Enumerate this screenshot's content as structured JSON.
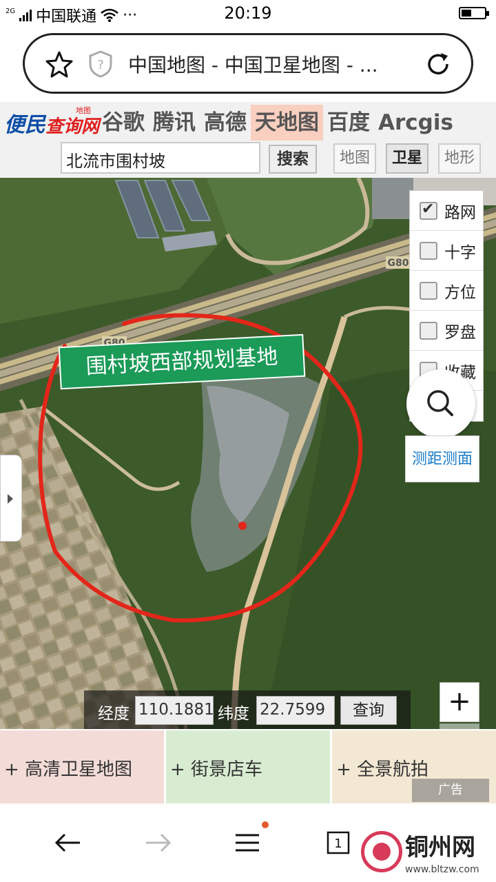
{
  "status": {
    "network": "2G",
    "carrier": "中国联通",
    "more": "···",
    "time": "20:19"
  },
  "browser": {
    "page_title": "中国地图 - 中国卫星地图 - ..."
  },
  "site": {
    "logo_main": "便民",
    "logo_sub": "查询网",
    "logo_tag": "地图",
    "tabs": [
      {
        "label": "谷歌",
        "active": false
      },
      {
        "label": "腾讯",
        "active": false
      },
      {
        "label": "高德",
        "active": false
      },
      {
        "label": "天地图",
        "active": true
      },
      {
        "label": "百度",
        "active": false
      },
      {
        "label": "Arcgis",
        "active": false
      }
    ],
    "search_value": "北流市围村坡",
    "search_button": "搜索",
    "map_types": [
      {
        "label": "地图",
        "selected": false
      },
      {
        "label": "卫星",
        "selected": true
      },
      {
        "label": "地形",
        "selected": false
      }
    ]
  },
  "map": {
    "annotation": "围村坡西部规划基地",
    "road_label": "G80",
    "layers": [
      {
        "label": "路网",
        "checked": true
      },
      {
        "label": "十字",
        "checked": false
      },
      {
        "label": "方位",
        "checked": false
      },
      {
        "label": "罗盘",
        "checked": false
      },
      {
        "label": "收藏",
        "checked": false
      }
    ],
    "measure_label": "测距测面",
    "coords": {
      "lon_label": "经度",
      "lon_value": "110.1881",
      "lat_label": "纬度",
      "lat_value": "22.7599",
      "query_button": "查询"
    },
    "zoom_in": "+",
    "zoom_out": "−"
  },
  "ads": [
    {
      "label": "+ 高清卫星地图"
    },
    {
      "label": "+ 街景店车"
    },
    {
      "label": "+ 全景航拍"
    }
  ],
  "ad_tag": "广告",
  "nav": {
    "tab_count": "1"
  },
  "watermark": {
    "name": "铜州网",
    "url": "www.bltzw.com"
  }
}
